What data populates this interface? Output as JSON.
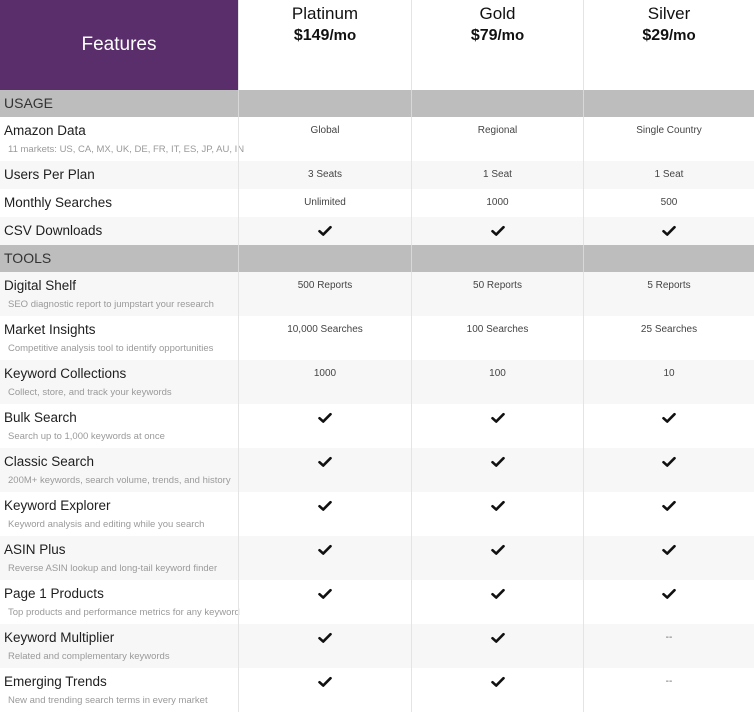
{
  "header": {
    "features_label": "Features",
    "plans": [
      {
        "name": "Platinum",
        "price": "$149",
        "per": "/mo"
      },
      {
        "name": "Gold",
        "price": "$79",
        "per": "/mo"
      },
      {
        "name": "Silver",
        "price": "$29",
        "per": "/mo"
      }
    ]
  },
  "colors": {
    "header_bg": "#5a2d6b",
    "section_bg": "#bdbdbd",
    "alt_row_bg": "#f7f7f7"
  },
  "sections": [
    {
      "title": "USAGE",
      "rows": [
        {
          "name": "Amazon Data",
          "desc": "11 markets: US, CA, MX, UK, DE, FR, IT, ES, JP, AU, IN",
          "values": [
            "Global",
            "Regional",
            "Single Country"
          ]
        },
        {
          "name": "Users Per Plan",
          "desc": "",
          "values": [
            "3 Seats",
            "1 Seat",
            "1 Seat"
          ]
        },
        {
          "name": "Monthly Searches",
          "desc": "",
          "values": [
            "Unlimited",
            "1000",
            "500"
          ]
        },
        {
          "name": "CSV Downloads",
          "desc": "",
          "values": [
            "check",
            "check",
            "check"
          ]
        }
      ]
    },
    {
      "title": "TOOLS",
      "rows": [
        {
          "name": "Digital Shelf",
          "desc": "SEO diagnostic report to jumpstart your research",
          "values": [
            "500 Reports",
            "50 Reports",
            "5 Reports"
          ]
        },
        {
          "name": "Market Insights",
          "desc": "Competitive analysis tool to identify opportunities",
          "values": [
            "10,000 Searches",
            "100 Searches",
            "25 Searches"
          ]
        },
        {
          "name": "Keyword Collections",
          "desc": "Collect, store, and track your keywords",
          "values": [
            "1000",
            "100",
            "10"
          ]
        },
        {
          "name": "Bulk Search",
          "desc": "Search up to 1,000 keywords at once",
          "values": [
            "check",
            "check",
            "check"
          ]
        },
        {
          "name": "Classic Search",
          "desc": "200M+ keywords, search volume, trends, and history",
          "values": [
            "check",
            "check",
            "check"
          ]
        },
        {
          "name": "Keyword Explorer",
          "desc": "Keyword analysis and editing while you search",
          "values": [
            "check",
            "check",
            "check"
          ]
        },
        {
          "name": "ASIN Plus",
          "desc": "Reverse ASIN lookup and long-tail keyword finder",
          "values": [
            "check",
            "check",
            "check"
          ]
        },
        {
          "name": "Page 1 Products",
          "desc": "Top products and performance metrics for any keyword",
          "values": [
            "check",
            "check",
            "check"
          ]
        },
        {
          "name": "Keyword Multiplier",
          "desc": "Related and complementary keywords",
          "values": [
            "check",
            "check",
            "--"
          ]
        },
        {
          "name": "Emerging Trends",
          "desc": "New and trending search terms in every market",
          "values": [
            "check",
            "check",
            "--"
          ]
        }
      ]
    }
  ]
}
